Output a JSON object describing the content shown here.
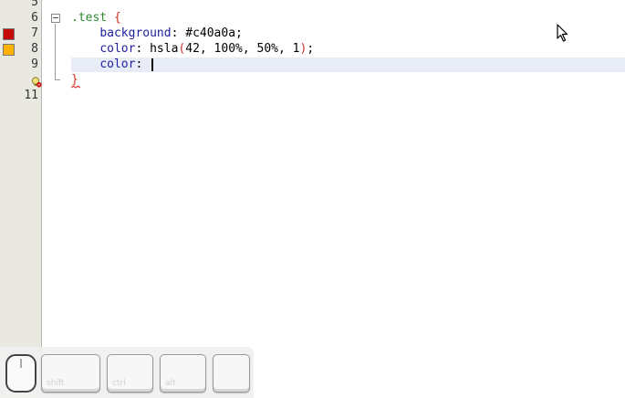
{
  "editor": {
    "line_numbers": [
      "5",
      "6",
      "7",
      "8",
      "9",
      "11"
    ],
    "code": {
      "selector": ".test",
      "open_brace": "{",
      "line7_prop": "background",
      "line7_colon": ":",
      "line7_value": "#c40a0a;",
      "line8_prop": "color",
      "line8_colon": ":",
      "line8_func": "hsla",
      "line8_open": "(",
      "line8_args": "42, 100%, 50%, 1",
      "line8_close": ")",
      "line8_semi": ";",
      "line9_prop": "color",
      "line9_colon": ":",
      "close_brace": "}"
    },
    "swatches": {
      "line7_color": "#c40a0a",
      "line8_color": "#ffb300"
    }
  },
  "keyboard_overlay": {
    "shift_label": "shift",
    "ctrl_label": "ctrl",
    "alt_label": "alt",
    "blank_label": ""
  }
}
